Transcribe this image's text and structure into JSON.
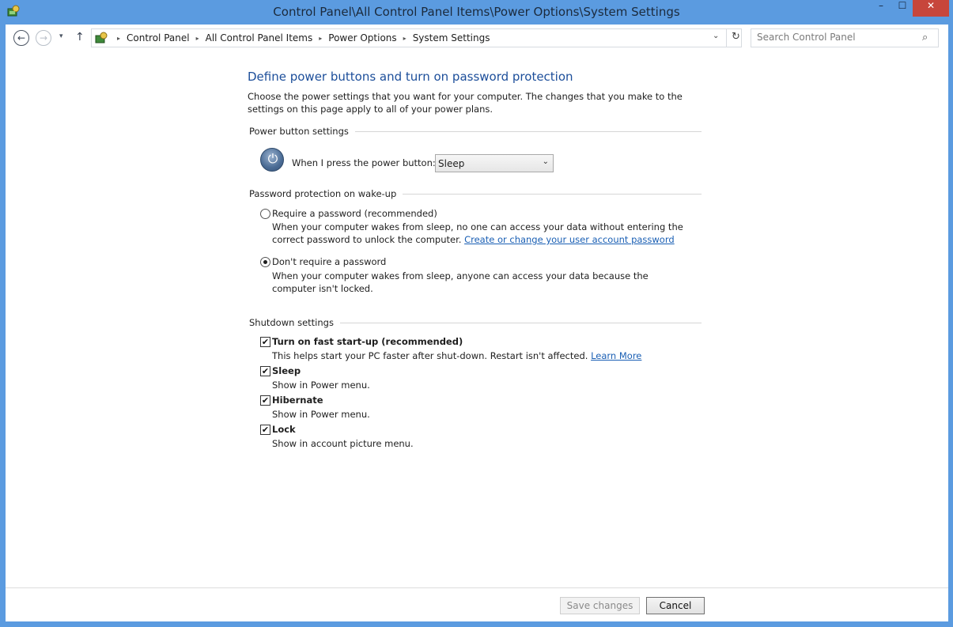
{
  "window": {
    "title": "Control Panel\\All Control Panel Items\\Power Options\\System Settings",
    "minimize": "–",
    "maximize": "☐",
    "close": "✕"
  },
  "nav": {
    "back": "←",
    "forward": "→",
    "recent": "▾",
    "up": "↑",
    "breadcrumb": [
      "Control Panel",
      "All Control Panel Items",
      "Power Options",
      "System Settings"
    ],
    "breadcrumb_sep": "▸",
    "address_dropdown": "⌄",
    "refresh": "↻",
    "search_placeholder": "Search Control Panel",
    "search_glyph": "⌕"
  },
  "page": {
    "heading": "Define power buttons and turn on password protection",
    "intro": "Choose the power settings that you want for your computer. The changes that you make to the settings on this page apply to all of your power plans."
  },
  "power_button": {
    "section": "Power button settings",
    "label": "When I press the power button:",
    "selected": "Sleep",
    "power_glyph": "⏻",
    "dropdown_arrow": "⌄"
  },
  "password": {
    "section": "Password protection on wake-up",
    "options": [
      {
        "label": "Require a password (recommended)",
        "desc_text": "When your computer wakes from sleep, no one can access your data without entering the correct password to unlock the computer.",
        "link": "Create or change your user account password",
        "selected": false
      },
      {
        "label": "Don't require a password",
        "desc_text": "When your computer wakes from sleep, anyone can access your data because the computer isn't locked.",
        "selected": true
      }
    ]
  },
  "shutdown": {
    "section": "Shutdown settings",
    "check_glyph": "✔",
    "items": [
      {
        "label": "Turn on fast start-up (recommended)",
        "desc": "This helps start your PC faster after shut-down. Restart isn't affected.",
        "link": "Learn More",
        "checked": true
      },
      {
        "label": "Sleep",
        "desc": "Show in Power menu.",
        "checked": true
      },
      {
        "label": "Hibernate",
        "desc": "Show in Power menu.",
        "checked": true
      },
      {
        "label": "Lock",
        "desc": "Show in account picture menu.",
        "checked": true
      }
    ]
  },
  "footer": {
    "save": "Save changes",
    "cancel": "Cancel"
  },
  "colors": {
    "window_frame": "#5b9be0",
    "heading": "#1c4e9a",
    "link": "#1a5fb4",
    "close_button": "#c7463b"
  }
}
